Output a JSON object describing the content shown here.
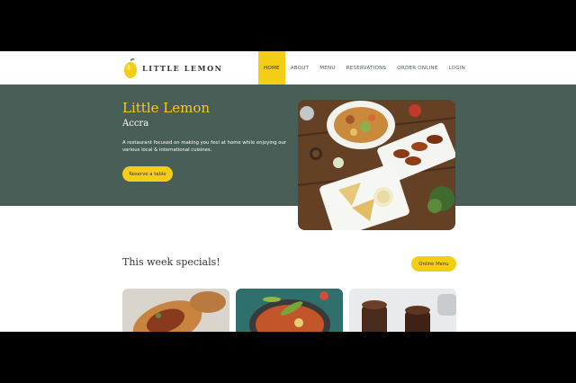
{
  "brand": {
    "name": "LITTLE LEMON",
    "logo_icon": "lemon-icon",
    "accent": "#f4ce14",
    "primary": "#495e57"
  },
  "nav": {
    "items": [
      {
        "label": "HOME",
        "active": true
      },
      {
        "label": "ABOUT",
        "active": false
      },
      {
        "label": "MENU",
        "active": false
      },
      {
        "label": "RESERVATIONS",
        "active": false
      },
      {
        "label": "ORDER ONLINE",
        "active": false
      },
      {
        "label": "LOGIN",
        "active": false
      }
    ]
  },
  "hero": {
    "title": "Little Lemon",
    "subtitle": "Accra",
    "description": "A restaurant focused on making you feel at home while enjoying our various local & international cuisines.",
    "cta_label": "Reserve a table"
  },
  "specials": {
    "title": "This week specials!",
    "cta_label": "Online Menu"
  }
}
